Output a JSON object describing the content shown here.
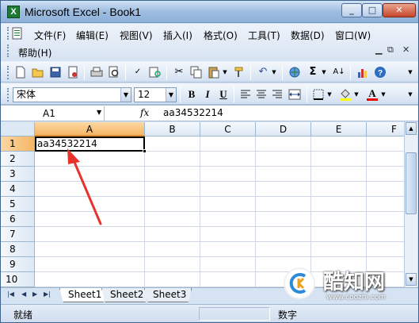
{
  "window": {
    "title": "Microsoft Excel - Book1",
    "app_icon_letter": "X"
  },
  "menu": {
    "items": [
      "文件(F)",
      "编辑(E)",
      "视图(V)",
      "插入(I)",
      "格式(O)",
      "工具(T)",
      "数据(D)",
      "窗口(W)"
    ],
    "help": "帮助(H)"
  },
  "font": {
    "name": "宋体",
    "size": "12"
  },
  "formula_bar": {
    "name_box": "A1",
    "fx": "fx",
    "content": "aa34532214"
  },
  "columns": [
    "A",
    "B",
    "C",
    "D",
    "E",
    "F"
  ],
  "rows": [
    "1",
    "2",
    "3",
    "4",
    "5",
    "6",
    "7",
    "8",
    "9",
    "10"
  ],
  "cells": {
    "A1": "aa34532214"
  },
  "selected_cell": "A1",
  "sheets": [
    "Sheet1",
    "Sheet2",
    "Sheet3"
  ],
  "active_sheet": "Sheet1",
  "status": {
    "left": "就绪",
    "mode": "数字"
  },
  "watermark": {
    "title": "酷知网",
    "url": "www.coozhi.com"
  },
  "colors": {
    "selection_header": "#f6b666",
    "annotation_arrow": "#e8322c",
    "titlebar": "#9fbde0"
  },
  "toolbar_icons": [
    "new-icon",
    "open-icon",
    "save-icon",
    "permission-icon",
    "print-icon",
    "print-preview-icon",
    "spelling-icon",
    "research-icon",
    "cut-icon",
    "copy-icon",
    "paste-icon",
    "format-painter-icon",
    "undo-icon",
    "hyperlink-icon",
    "autosum-icon",
    "sort-icon",
    "chart-icon",
    "help-icon"
  ]
}
